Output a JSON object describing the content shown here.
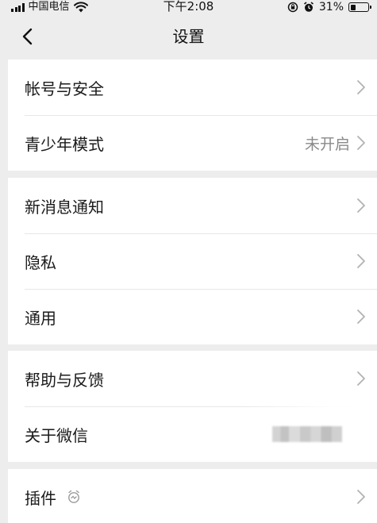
{
  "status_bar": {
    "carrier": "中国电信",
    "time": "下午2:08",
    "battery_percent": "31%",
    "battery_level": 0.31,
    "icons": [
      "signal-icon",
      "wifi-icon",
      "rotation-lock-icon",
      "alarm-icon",
      "battery-icon"
    ]
  },
  "nav": {
    "title": "设置",
    "back_icon": "chevron-left-icon"
  },
  "groups": [
    {
      "items": [
        {
          "label": "帐号与安全",
          "value": ""
        },
        {
          "label": "青少年模式",
          "value": "未开启"
        }
      ]
    },
    {
      "items": [
        {
          "label": "新消息通知",
          "value": ""
        },
        {
          "label": "隐私",
          "value": ""
        },
        {
          "label": "通用",
          "value": ""
        }
      ]
    },
    {
      "items": [
        {
          "label": "帮助与反馈",
          "value": ""
        },
        {
          "label": "关于微信",
          "value": ""
        }
      ]
    },
    {
      "items": [
        {
          "label": "插件",
          "value": "",
          "icon": "plugin-icon"
        }
      ]
    }
  ],
  "colors": {
    "background": "#ededed",
    "card": "#ffffff",
    "secondary_text": "#8a8a8a",
    "chevron": "#b2b2b2",
    "divider": "#e7e7e7"
  }
}
